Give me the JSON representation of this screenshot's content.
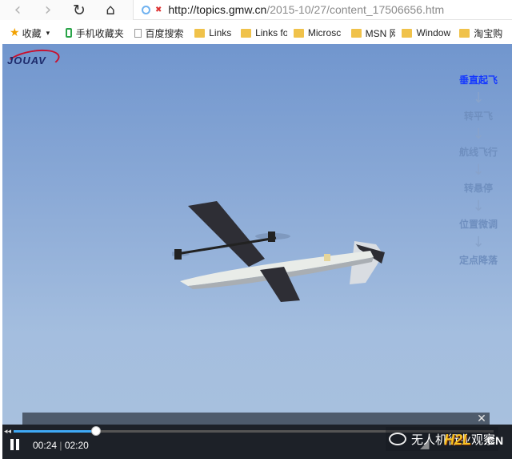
{
  "browser": {
    "url_host": "http://topics.gmw.cn",
    "url_path": "/2015-10/27/content_17506656.htm",
    "nav_icons": {
      "back": "‹",
      "forward": "›",
      "reload": "↻",
      "home": "⌂",
      "insecure": "✖"
    }
  },
  "bookmarks": [
    {
      "label": "收藏",
      "icon": "star-icon",
      "extra": "▾"
    },
    {
      "label": "手机收藏夹",
      "icon": "phone-icon"
    },
    {
      "label": "百度搜索",
      "icon": "page-icon"
    },
    {
      "label": "Links",
      "icon": "folder-icon"
    },
    {
      "label": "Links fo",
      "icon": "folder-icon"
    },
    {
      "label": "Microsc",
      "icon": "folder-icon"
    },
    {
      "label": "MSN 网",
      "icon": "folder-icon"
    },
    {
      "label": "Window",
      "icon": "folder-icon"
    },
    {
      "label": "淘宝购",
      "icon": "folder-icon"
    }
  ],
  "video": {
    "logo": "JOUAV",
    "flow_steps": [
      "垂直起飞",
      "转平飞",
      "航线飞行",
      "转悬停",
      "位置微调",
      "定点降落"
    ],
    "flow_active_index": 0,
    "arrow_glyph": "↓",
    "current_time": "00:24",
    "separator": " | ",
    "duration": "02:20",
    "progress": 0.171,
    "close_glyph": "✕",
    "seek_glyph": "◂◂",
    "volume_glyph": "◢",
    "watermark": {
      "text": "无人机行业观察",
      "brand": "H2L",
      "brand_suffix": ".CN"
    }
  },
  "colors": {
    "progress": "#3fa9f5",
    "flow_active": "#1438ff",
    "flow": "#6f8fbf",
    "sky_top": "#7196ce"
  }
}
